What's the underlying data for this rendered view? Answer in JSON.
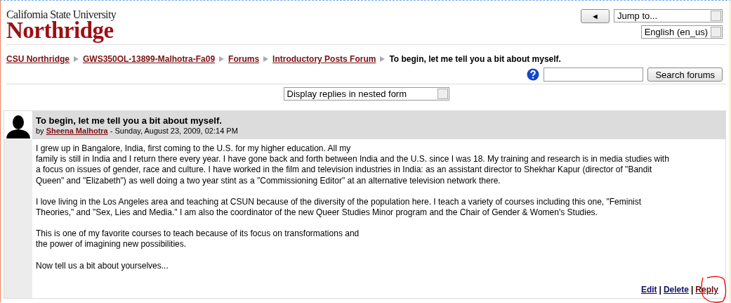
{
  "logo": {
    "top": "California State University",
    "main": "Northridge"
  },
  "nav": {
    "back_button": "◄",
    "jump_menu": "Jump to...",
    "language": "English (en_us)"
  },
  "breadcrumb": [
    {
      "label": "CSU Northridge",
      "kind": "link"
    },
    {
      "label": "GWS350OL-13899-Malhotra-Fa09",
      "kind": "link"
    },
    {
      "label": "Forums",
      "kind": "link"
    },
    {
      "label": "Introductory Posts Forum",
      "kind": "link"
    },
    {
      "label": "To begin, let me tell you a bit about myself.",
      "kind": "current"
    }
  ],
  "search": {
    "button": "Search forums"
  },
  "display_mode": "Display replies in nested form",
  "post": {
    "subject": "To begin, let me tell you a bit about myself.",
    "by": "by",
    "author": "Sheena Malhotra",
    "date": "- Sunday, August 23, 2009, 02:14 PM",
    "paragraphs": [
      [
        "I grew up in Bangalore, India, first coming to the U.S. for my higher education. All my",
        "family is still in India and I return there every year. I have gone back and forth between India and the U.S. since I was 18. My training and research is in media studies with",
        "a focus on issues of gender, race and culture. I have worked in the film and television industries in India: as an assistant director to Shekhar Kapur (director of \"Bandit",
        "Queen\" and \"Elizabeth\") as well doing a two year stint as a \"Commissioning Editor\" at an alternative television network there."
      ],
      [
        "I love living in the Los Angeles area and teaching at CSUN because of the diversity of the population here. I teach a variety of courses including this one, \"Feminist",
        "Theories,\" and \"Sex, Lies and Media.\" I am also the coordinator of the new Queer Studies Minor program and the Chair of Gender & Women's Studies."
      ],
      [
        "This is one of my favorite courses to teach because of its focus on transformations and",
        "the power of imagining new possibilities."
      ],
      [
        "Now tell us a bit about yourselves..."
      ]
    ],
    "commands": [
      {
        "label": "Edit",
        "circled": false
      },
      {
        "label": "Delete",
        "circled": false
      },
      {
        "label": "Reply",
        "circled": true
      }
    ],
    "separator": "|"
  }
}
